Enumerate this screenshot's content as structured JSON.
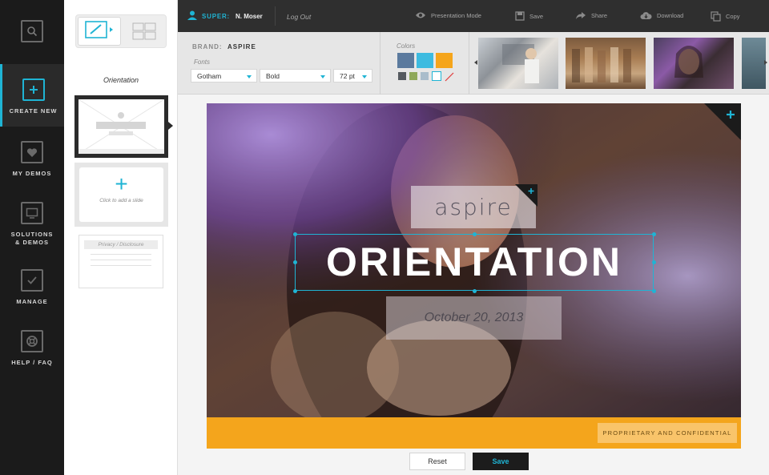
{
  "rail": {
    "items": [
      {
        "label": "",
        "icon": "search-icon"
      },
      {
        "label": "CREATE NEW",
        "icon": "plus-icon"
      },
      {
        "label": "MY DEMOS",
        "icon": "heart-icon"
      },
      {
        "label": "SOLUTIONS\n& DEMOS",
        "icon": "monitor-icon"
      },
      {
        "label": "MANAGE",
        "icon": "check-icon"
      },
      {
        "label": "HELP / FAQ",
        "icon": "lifebuoy-icon"
      }
    ]
  },
  "thumbs": {
    "orientation_label": "Orientation",
    "add_slide_text": "Click to add a slide",
    "privacy_label": "Privacy / Disclosure"
  },
  "topbar": {
    "role": "SUPER:",
    "user": "N. Moser",
    "logout": "Log Out",
    "actions": [
      {
        "label": "Presentation Mode",
        "icon": "eye-icon"
      },
      {
        "label": "Save",
        "icon": "save-icon"
      },
      {
        "label": "Share",
        "icon": "share-icon"
      },
      {
        "label": "Download",
        "icon": "cloud-download-icon"
      },
      {
        "label": "Copy",
        "icon": "copy-icon"
      }
    ]
  },
  "toolbar": {
    "brand_prefix": "BRAND:",
    "brand_name": "ASPIRE",
    "fonts_label": "Fonts",
    "font_family": "Gotham",
    "font_weight": "Bold",
    "font_size": "72 pt",
    "colors_label": "Colors",
    "primary_colors": [
      "#5b7a9e",
      "#3dbbe0",
      "#f5a51b"
    ],
    "secondary_colors": [
      "#555a60",
      "#8fa85a",
      "#a9bccb",
      "#ffffff"
    ]
  },
  "slide": {
    "brand_word": "aspire",
    "title": "ORIENTATION",
    "date": "October 20, 2013",
    "confidential": "PROPRIETARY AND CONFIDENTIAL"
  },
  "buttons": {
    "reset": "Reset",
    "save": "Save"
  }
}
